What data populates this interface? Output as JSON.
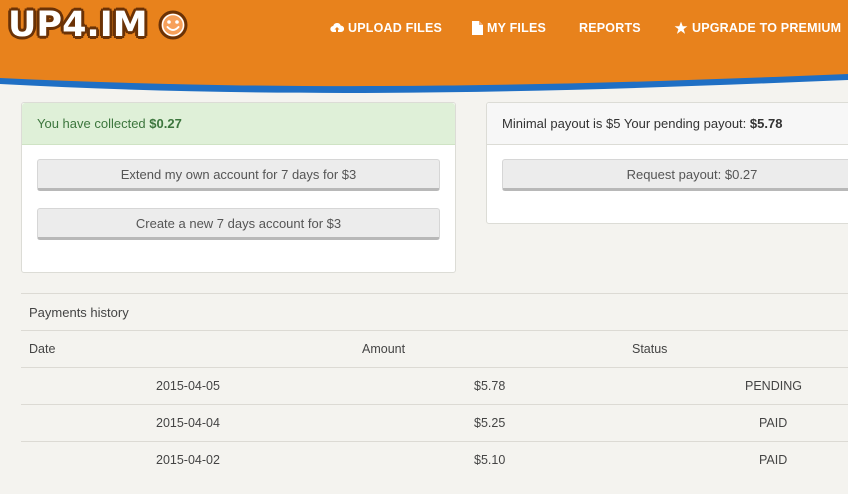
{
  "brand": {
    "logo_text": "UP4.IM"
  },
  "nav": {
    "upload_label": "UPLOAD FILES",
    "my_files_label": "MY FILES",
    "reports_label": "REPORTS",
    "upgrade_label": "UPGRADE TO PREMIUM"
  },
  "collected": {
    "prefix": "You have collected",
    "amount": "$0.27",
    "extend_button": "Extend my own account for 7 days for $3",
    "create_button": "Create a new 7 days account for $3"
  },
  "payout": {
    "info_text": "Minimal payout is $5 Your pending payout:",
    "pending_amount": "$5.78",
    "request_button": "Request payout: $0.27"
  },
  "history": {
    "title": "Payments history",
    "columns": {
      "date": "Date",
      "amount": "Amount",
      "status": "Status"
    },
    "rows": [
      {
        "date": "2015-04-05",
        "amount": "$5.78",
        "status": "PENDING"
      },
      {
        "date": "2015-04-04",
        "amount": "$5.25",
        "status": "PAID"
      },
      {
        "date": "2015-04-02",
        "amount": "$5.10",
        "status": "PAID"
      }
    ]
  },
  "colors": {
    "header": "#e8821c",
    "wave": "#1f6fc4",
    "success_bg": "#dff0d8",
    "success_text": "#3c763d"
  }
}
